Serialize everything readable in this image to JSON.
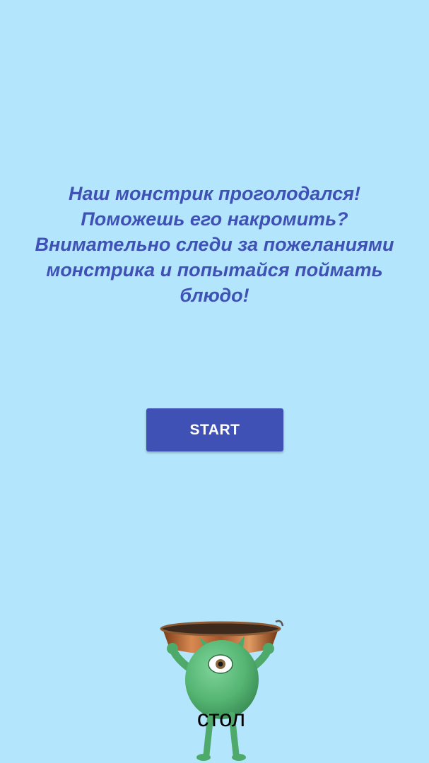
{
  "intro": {
    "lines": [
      "Наш монстрик проголодался!",
      "Поможешь его накромить?",
      "Внимательно следи за пожеланиями",
      "монстрика и попытайся поймать",
      "блюдо!"
    ]
  },
  "start_button": {
    "label": "START"
  },
  "game": {
    "character": "green-one-eyed-monster",
    "held_item": "copper-basket",
    "food_label": "стол"
  },
  "colors": {
    "background": "#b3e5fc",
    "accent": "#3f51b5",
    "button_text": "#ffffff",
    "monster": "#5cb878",
    "basket": "#b5652e"
  }
}
